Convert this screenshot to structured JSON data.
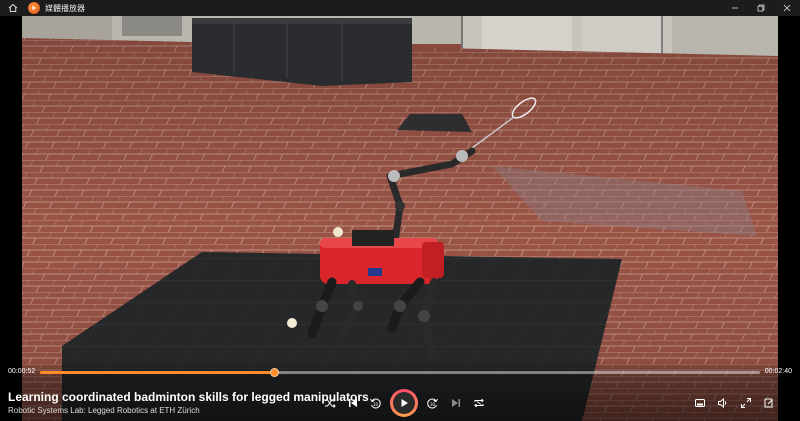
{
  "window": {
    "title": "媒體播放器"
  },
  "player": {
    "current_time": "00:00:52",
    "total_time": "00:02:40",
    "progress_fraction": 0.325,
    "video_title": "Learning coordinated badminton skills for legged manipulators",
    "video_subtitle": "Robotic Systems Lab: Legged Robotics at ETH Zürich"
  },
  "colors": {
    "accent": "#ff8a2a",
    "titlebar": "#1c1c1c"
  },
  "icons": {
    "home": "home-icon",
    "app": "media-player-icon",
    "shuffle": "shuffle-icon",
    "previous": "previous-icon",
    "rewind": "rewind-10-icon",
    "play": "play-icon",
    "forward": "forward-30-icon",
    "next": "next-icon",
    "repeat": "repeat-icon",
    "miniplayer": "miniplayer-icon",
    "volume": "volume-icon",
    "fullscreen": "fullscreen-icon",
    "more": "more-icon"
  }
}
